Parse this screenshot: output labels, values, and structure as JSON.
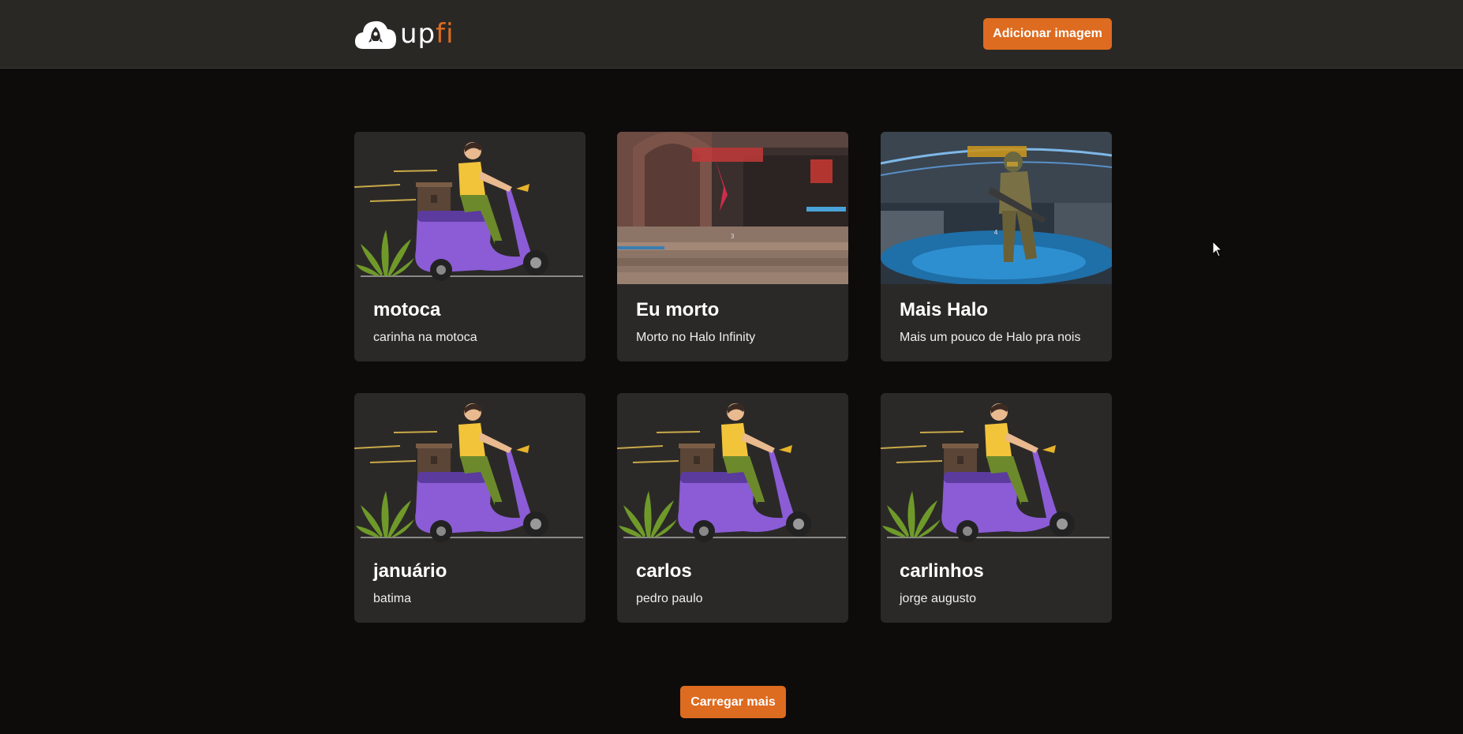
{
  "header": {
    "logo_text_main": "up",
    "logo_text_accent": "fi",
    "add_image_label": "Adicionar imagem"
  },
  "cards": [
    {
      "title": "motoca",
      "description": "carinha na motoca",
      "image": "scooter-illustration"
    },
    {
      "title": "Eu morto",
      "description": "Morto no Halo Infinity",
      "image": "halo-screenshot-stairs"
    },
    {
      "title": "Mais Halo",
      "description": "Mais um pouco de Halo pra nois",
      "image": "halo-screenshot-spartan"
    },
    {
      "title": "januário",
      "description": "batima",
      "image": "scooter-illustration"
    },
    {
      "title": "carlos",
      "description": "pedro paulo",
      "image": "scooter-illustration"
    },
    {
      "title": "carlinhos",
      "description": "jorge augusto",
      "image": "scooter-illustration"
    }
  ],
  "load_more_label": "Carregar mais",
  "colors": {
    "accent": "#dd6b20",
    "background": "#0e0c0b",
    "header": "#2a2825",
    "card": "#2b2927"
  }
}
